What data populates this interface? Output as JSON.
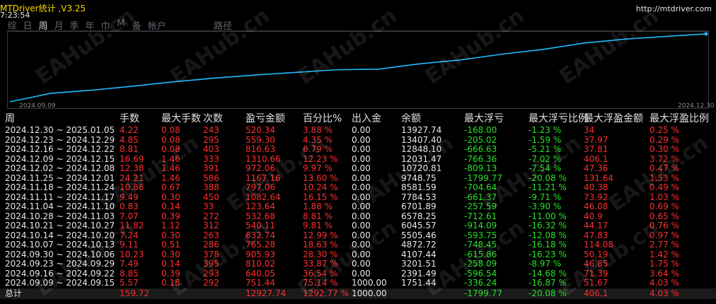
{
  "app": {
    "title": "MTDriver统计 ,V3.25",
    "url": "http://mtdriver.com",
    "time": "7:23:54"
  },
  "tabs": [
    "综",
    "日",
    "周",
    "月",
    "季",
    "年",
    "巾",
    "M",
    "备",
    "帐户"
  ],
  "active_tab": 2,
  "tab_path": "路径",
  "chart": {
    "x_start": "2024.09.09",
    "x_end": "2024.12.30",
    "line_color": "#22b8ff",
    "values": [
      1751.44,
      2391.49,
      3201.51,
      4107.44,
      4872.72,
      5505.46,
      6045.57,
      6578.25,
      6701.89,
      7784.53,
      8581.59,
      9748.75,
      10720.81,
      12031.47,
      12848.1,
      13407.4,
      13927.74
    ]
  },
  "table": {
    "headers": [
      "周",
      "手数",
      "最大手数",
      "次数",
      "盈亏金额",
      "百分比%",
      "出入金",
      "余额",
      "最大浮亏",
      "最大浮亏比例",
      "最大浮盈金额",
      "最大浮盈比例"
    ],
    "rows": [
      [
        "2024.12.30 ~ 2025.01.05",
        "4.22",
        "0.08",
        "243",
        "520.34",
        "3.88 %",
        "0.00",
        "13927.74",
        "-168.00",
        "-1.23 %",
        "34",
        "0.25 %"
      ],
      [
        "2024.12.23 ~ 2024.12.29",
        "4.85",
        "0.08",
        "295",
        "559.30",
        "4.35 %",
        "0.00",
        "13407.40",
        "-205.02",
        "-1.59 %",
        "37.97",
        "0.29 %"
      ],
      [
        "2024.12.16 ~ 2024.12.22",
        "8.81",
        "0.08",
        "403",
        "816.63",
        "6.79 %",
        "0.00",
        "12848.10",
        "-666.63",
        "-5.21 %",
        "37.81",
        "0.30 %"
      ],
      [
        "2024.12.09 ~ 2024.12.15",
        "16.69",
        "1.46",
        "333",
        "1310.66",
        "12.23 %",
        "0.00",
        "12031.47",
        "-766.36",
        "-7.02 %",
        "406.1",
        "3.72 %"
      ],
      [
        "2024.12.02 ~ 2024.12.08",
        "12.38",
        "1.46",
        "391",
        "972.06",
        "9.97 %",
        "0.00",
        "10720.81",
        "-809.13",
        "-7.54 %",
        "47.36",
        "0.47 %"
      ],
      [
        "2024.11.25 ~ 2024.12.01",
        "24.21",
        "1.46",
        "586",
        "1167.16",
        "13.60 %",
        "0.00",
        "9748.75",
        "-1799.77",
        "-20.08 %",
        "131.64",
        "1.53 %"
      ],
      [
        "2024.11.18 ~ 2024.11.24",
        "10.86",
        "0.67",
        "388",
        "797.06",
        "10.24 %",
        "0.00",
        "8581.59",
        "-704.64",
        "-11.21 %",
        "40.38",
        "0.49 %"
      ],
      [
        "2024.11.11 ~ 2024.11.17",
        "9.49",
        "0.30",
        "450",
        "1082.64",
        "16.15 %",
        "0.00",
        "7784.53",
        "-661.37",
        "-9.71 %",
        "73.92",
        "1.03 %"
      ],
      [
        "2024.11.04 ~ 2024.11.10",
        "0.83",
        "0.14",
        "33",
        "123.64",
        "1.88 %",
        "0.00",
        "6701.89",
        "-257.59",
        "-3.90 %",
        "46.08",
        "0.69 %"
      ],
      [
        "2024.10.28 ~ 2024.11.03",
        "7.07",
        "0.39",
        "272",
        "532.68",
        "8.81 %",
        "0.00",
        "6578.25",
        "-712.61",
        "-11.00 %",
        "40.9",
        "0.65 %"
      ],
      [
        "2024.10.21 ~ 2024.10.27",
        "11.82",
        "1.12",
        "312",
        "540.11",
        "9.81 %",
        "0.00",
        "6045.57",
        "-914.09",
        "-16.32 %",
        "44.17",
        "0.76 %"
      ],
      [
        "2024.10.14 ~ 2024.10.20",
        "7.24",
        "0.30",
        "263",
        "632.74",
        "12.99 %",
        "0.00",
        "5505.46",
        "-593.75",
        "-12.08 %",
        "47.83",
        "0.97 %"
      ],
      [
        "2024.10.07 ~ 2024.10.13",
        "9.11",
        "0.51",
        "286",
        "765.28",
        "18.63 %",
        "0.00",
        "4872.72",
        "-748.45",
        "-16.18 %",
        "114.08",
        "2.77 %"
      ],
      [
        "2024.09.30 ~ 2024.10.06",
        "10.23",
        "0.30",
        "378",
        "905.93",
        "28.30 %",
        "0.00",
        "4107.44",
        "-615.86",
        "-16.23 %",
        "50.19",
        "1.42 %"
      ],
      [
        "2024.09.23 ~ 2024.09.29",
        "7.49",
        "0.14",
        "395",
        "810.02",
        "33.87 %",
        "0.00",
        "3201.51",
        "-258.09",
        "-8.97 %",
        "46.85",
        "1.75 %"
      ],
      [
        "2024.09.16 ~ 2024.09.22",
        "8.85",
        "0.39",
        "293",
        "640.05",
        "36.54 %",
        "0.00",
        "2391.49",
        "-596.54",
        "-14.68 %",
        "71.39",
        "3.64 %"
      ],
      [
        "2024.09.09 ~ 2024.09.15",
        "5.57",
        "0.18",
        "292",
        "751.44",
        "75.14 %",
        "1000.00",
        "1751.44",
        "-336.24",
        "-16.87 %",
        "51.67",
        "4.03 %"
      ]
    ],
    "total": [
      "总计",
      "159.72",
      "",
      "",
      "12927.74",
      "1292.77 %",
      "1000.00",
      "",
      "-1799.77",
      "-20.08 %",
      "406.1",
      "4.03 %"
    ]
  },
  "watermark": "EAHub.cn"
}
